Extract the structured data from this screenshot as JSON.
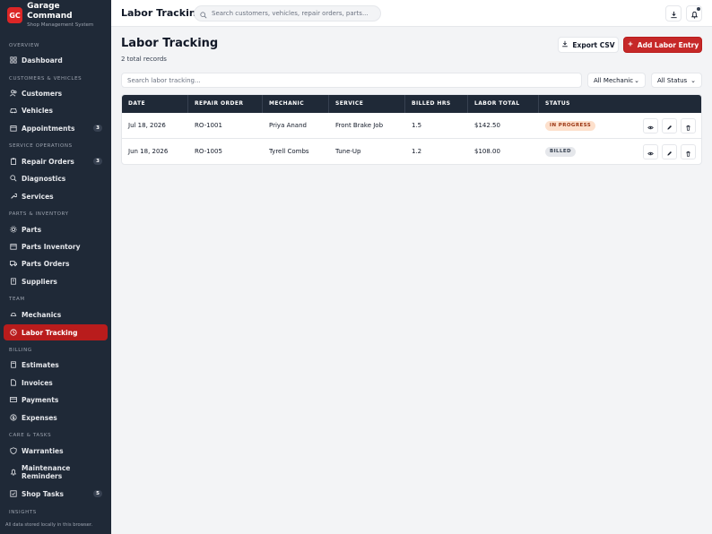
{
  "brand": {
    "logo": "GC",
    "name": "Garage Command",
    "subtitle": "Shop Management System"
  },
  "sidebar": {
    "sections": [
      {
        "label": "Overview"
      },
      {
        "label": "Customers & Vehicles"
      },
      {
        "label": "Service Operations"
      },
      {
        "label": "Parts & Inventory"
      },
      {
        "label": "Team"
      },
      {
        "label": "Billing"
      },
      {
        "label": "Care & Tasks"
      },
      {
        "label": "Insights"
      }
    ],
    "items": [
      {
        "label": "Dashboard",
        "icon": "grid-icon"
      },
      {
        "label": "Customers",
        "icon": "users-icon"
      },
      {
        "label": "Vehicles",
        "icon": "car-icon"
      },
      {
        "label": "Appointments",
        "icon": "calendar-icon",
        "badge": "3"
      },
      {
        "label": "Repair Orders",
        "icon": "clipboard-icon",
        "badge": "3"
      },
      {
        "label": "Diagnostics",
        "icon": "search-icon"
      },
      {
        "label": "Services",
        "icon": "wrench-icon"
      },
      {
        "label": "Parts",
        "icon": "gear-icon"
      },
      {
        "label": "Parts Inventory",
        "icon": "box-icon"
      },
      {
        "label": "Parts Orders",
        "icon": "truck-icon"
      },
      {
        "label": "Suppliers",
        "icon": "building-icon"
      },
      {
        "label": "Mechanics",
        "icon": "hard-hat-icon"
      },
      {
        "label": "Labor Tracking",
        "icon": "clock-icon",
        "active": true
      },
      {
        "label": "Estimates",
        "icon": "calculator-icon"
      },
      {
        "label": "Invoices",
        "icon": "file-icon"
      },
      {
        "label": "Payments",
        "icon": "credit-card-icon"
      },
      {
        "label": "Expenses",
        "icon": "dollar-icon"
      },
      {
        "label": "Warranties",
        "icon": "shield-icon"
      },
      {
        "label": "Maintenance Reminders",
        "icon": "bell-icon"
      },
      {
        "label": "Shop Tasks",
        "icon": "checkbox-icon",
        "badge": "5"
      }
    ],
    "footer": "All data stored locally in this browser."
  },
  "topbar": {
    "title": "Labor Tracking",
    "search_placeholder": "Search customers, vehicles, repair orders, parts...",
    "download_icon": "download-icon",
    "notifications_icon": "bell-icon"
  },
  "main": {
    "title": "Labor Tracking",
    "subtitle": "2 total records",
    "export_label": "Export CSV",
    "add_label": "Add Labor Entry",
    "filter_placeholder": "Search labor tracking...",
    "mechanic_filter": "All Mechanic",
    "status_filter": "All Status"
  },
  "table": {
    "headers": [
      "DATE",
      "REPAIR ORDER",
      "MECHANIC",
      "SERVICE",
      "BILLED HRS",
      "LABOR TOTAL",
      "STATUS"
    ],
    "rows": [
      {
        "date": "Jul 18, 2026",
        "repair_order": "RO-1001",
        "mechanic": "Priya Anand",
        "service": "Front Brake Job",
        "billed_hrs": "1.5",
        "labor_total": "$142.50",
        "status": "IN PROGRESS"
      },
      {
        "date": "Jun 18, 2026",
        "repair_order": "RO-1005",
        "mechanic": "Tyrell Combs",
        "service": "Tune-Up",
        "billed_hrs": "1.2",
        "labor_total": "$108.00",
        "status": "BILLED"
      }
    ]
  },
  "colors": {
    "accent": "#c62828",
    "sidebar": "#1f2937",
    "in_progress_bg": "#fde0cc",
    "billed_bg": "#e5e7eb"
  }
}
